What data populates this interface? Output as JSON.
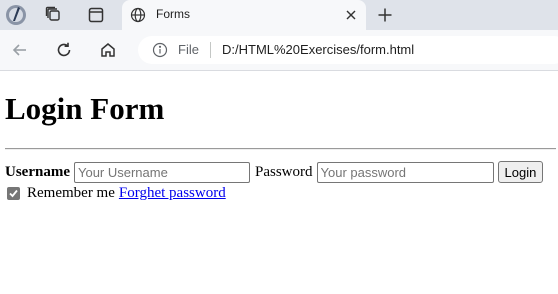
{
  "browser": {
    "active_tab": {
      "title": "Forms",
      "icon": "globe-icon"
    },
    "other_tab_icons": [
      "profile-avatar-icon",
      "collections-icon",
      "vertical-tabs-icon"
    ],
    "address_bar": {
      "scheme_label": "File",
      "url": "D:/HTML%20Exercises/form.html"
    },
    "nav_icons": [
      "back-icon",
      "reload-icon",
      "home-icon"
    ]
  },
  "page": {
    "heading": "Login Form",
    "username_label": "Username",
    "username_placeholder": "Your Username",
    "password_label": "Password",
    "password_placeholder": "Your password",
    "login_button": "Login",
    "remember_checked": true,
    "remember_label": "Remember me",
    "forgot_link": "Forghet password"
  }
}
